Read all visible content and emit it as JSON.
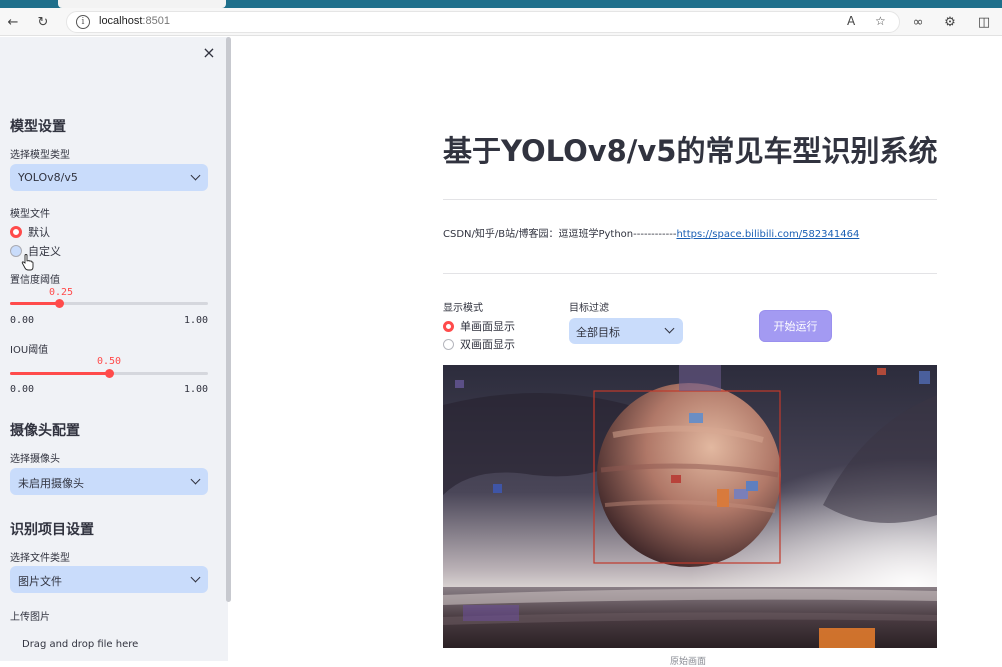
{
  "browser": {
    "url_host": "localhost",
    "url_port": ":8501"
  },
  "sidebar": {
    "close_icon": "×",
    "model_section": {
      "heading": "模型设置",
      "model_type_label": "选择模型类型",
      "model_type_value": "YOLOv8/v5",
      "model_file_label": "模型文件",
      "model_file_options": [
        "默认",
        "自定义"
      ],
      "model_file_selected": "默认",
      "confidence": {
        "label": "置信度阈值",
        "value": 0.25,
        "display": "0.25",
        "min": "0.00",
        "max": "1.00"
      },
      "iou": {
        "label": "IOU阈值",
        "value": 0.5,
        "display": "0.50",
        "min": "0.00",
        "max": "1.00"
      }
    },
    "camera_section": {
      "heading": "摄像头配置",
      "camera_label": "选择摄像头",
      "camera_value": "未启用摄像头"
    },
    "recognition_section": {
      "heading": "识别项目设置",
      "file_type_label": "选择文件类型",
      "file_type_value": "图片文件",
      "upload_label": "上传图片",
      "drop_text": "Drag and drop file here"
    }
  },
  "main": {
    "title": "基于YOLOv8/v5的常见车型识别系统",
    "credit_prefix": "CSDN/知乎/B站/博客园：逗逗班学Python------------",
    "credit_link": "https://space.bilibili.com/582341464",
    "display_mode": {
      "label": "显示模式",
      "options": [
        "单画面显示",
        "双画面显示"
      ],
      "selected": "单画面显示"
    },
    "target_filter": {
      "label": "目标过滤",
      "value": "全部目标"
    },
    "run_button": "开始运行",
    "image_caption": "原始画面"
  },
  "colors": {
    "accent": "#ff4b4b",
    "select_bg": "#c9dcfb",
    "button": "#a39af2",
    "sidebar_bg": "#f0f2f6"
  }
}
